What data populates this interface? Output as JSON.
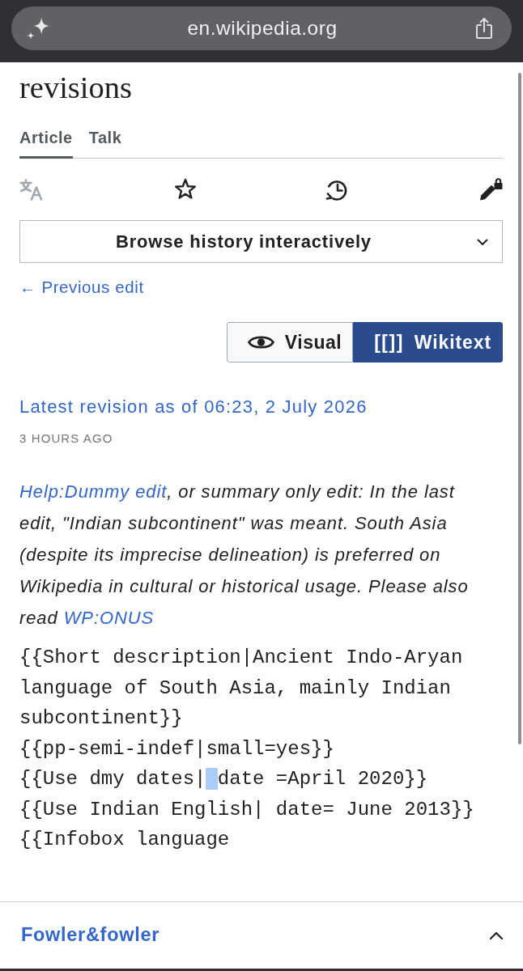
{
  "browser": {
    "url": "en.wikipedia.org"
  },
  "page": {
    "title": "revisions",
    "tabs": [
      {
        "label": "Article",
        "selected": true
      },
      {
        "label": "Talk",
        "selected": false
      }
    ],
    "page_actions": [
      {
        "disabled": true
      },
      {
        "disabled": false
      },
      {
        "disabled": false
      },
      {
        "disabled": false
      }
    ],
    "history_menu": {
      "label": "Browse history interactively"
    },
    "previous_edit": {
      "label": "← Previous edit"
    },
    "view_toggle": [
      {
        "kind": "visual",
        "label": "Visual",
        "selected": false
      },
      {
        "kind": "wikitext",
        "glyph": "[[]]",
        "label": "Wikitext",
        "selected": true
      }
    ],
    "revision": {
      "heading": "Latest revision as of 06:23, 2 July 2026",
      "age": "3 HOURS AGO"
    },
    "summary": [
      {
        "kind": "link",
        "text": "Help:Dummy edit"
      },
      {
        "kind": "text",
        "text": ", or summary only edit: In the last edit, \"Indian subcontinent\" was meant. South Asia (despite its imprecise delineation) is preferred on Wikipedia in cultural or historical usage. Please also read "
      },
      {
        "kind": "link",
        "text": "WP:ONUS"
      }
    ],
    "wikitext_lines": [
      {
        "text": "{{Short description|Ancient Indo-Aryan language of South Asia, mainly Indian subcontinent}}"
      },
      {
        "text": "{{pp-semi-indef|small=yes}}"
      },
      {
        "text": "{{Use dmy dates|",
        "selection": true,
        "text_after": "date =April 2020}}"
      },
      {
        "text": "{{Use Indian English| date= June 2013}}"
      },
      {
        "text": "{{Infobox language"
      }
    ],
    "footer": {
      "author": "Fowler&fowler"
    }
  }
}
